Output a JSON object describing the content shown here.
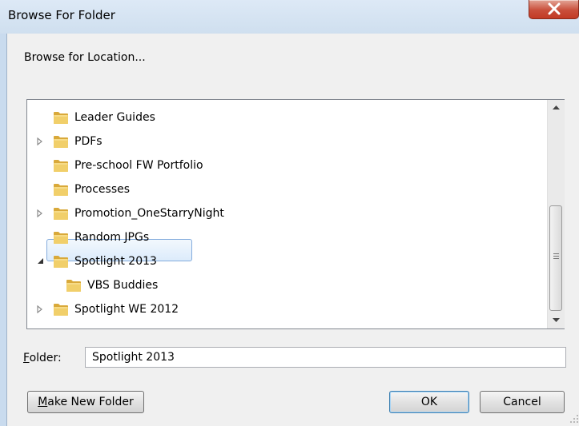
{
  "window": {
    "title": "Browse For Folder"
  },
  "dialog": {
    "prompt": "Browse for Location..."
  },
  "tree": {
    "items": [
      {
        "label": "Leader Guides",
        "expander": "none",
        "indent": 0
      },
      {
        "label": "PDFs",
        "expander": "collapsed",
        "indent": 0
      },
      {
        "label": "Pre-school FW Portfolio",
        "expander": "none",
        "indent": 0
      },
      {
        "label": "Processes",
        "expander": "none",
        "indent": 0
      },
      {
        "label": "Promotion_OneStarryNight",
        "expander": "collapsed",
        "indent": 0
      },
      {
        "label": "Random JPGs",
        "expander": "none",
        "indent": 0
      },
      {
        "label": "Spotlight 2013",
        "expander": "expanded",
        "indent": 0,
        "selected": true
      },
      {
        "label": "VBS Buddies",
        "expander": "none",
        "indent": 1
      },
      {
        "label": "Spotlight WE 2012",
        "expander": "collapsed",
        "indent": 0
      }
    ]
  },
  "folder_field": {
    "label_prefix": "",
    "label_accel": "F",
    "label_rest": "older:",
    "value": "Spotlight 2013"
  },
  "buttons": {
    "make_new_folder_accel": "M",
    "make_new_folder_rest": "ake New Folder",
    "ok": "OK",
    "cancel": "Cancel"
  },
  "colors": {
    "folder": "#e8c45a",
    "selection_border": "#84acdd",
    "close": "#c94f3b"
  },
  "icons": {
    "close": "close-icon",
    "folder": "folder-icon",
    "expander": "triangle-icon"
  }
}
